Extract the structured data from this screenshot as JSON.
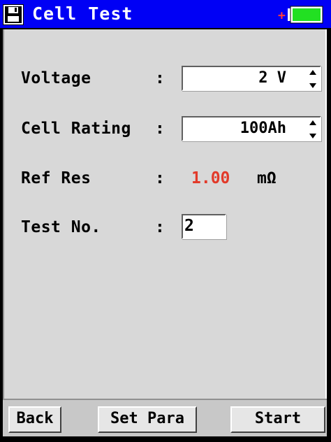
{
  "window": {
    "title": "Cell Test",
    "icon": "floppy-disk-icon",
    "colors": {
      "titlebar": "#0000f5",
      "panel": "#d8d8d8",
      "ref_value": "#e23a2a",
      "battery_fill": "#22e022",
      "battery_plus": "#ff3b3b"
    }
  },
  "battery": {
    "plus_symbol": "+",
    "level": 1.0
  },
  "form": {
    "voltage": {
      "label": "Voltage",
      "colon": ":",
      "value": "2 V"
    },
    "cell_rating": {
      "label": "Cell Rating",
      "colon": ":",
      "value": "100Ah"
    },
    "ref_res": {
      "label": "Ref Res",
      "colon": ":",
      "value": "1.00",
      "unit": "mΩ"
    },
    "test_no": {
      "label": "Test No.",
      "colon": ":",
      "value": "2"
    }
  },
  "buttons": {
    "back": "Back",
    "set_para": "Set Para",
    "start": "Start"
  }
}
